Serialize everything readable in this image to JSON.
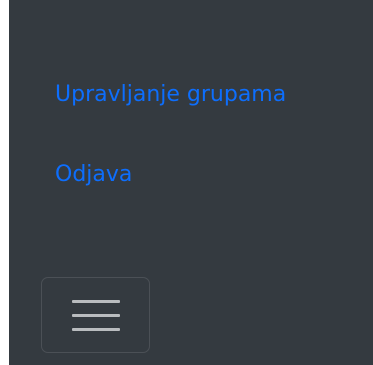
{
  "navbar": {
    "background_color": "#343a40",
    "link_color": "#0d6efd",
    "links": [
      {
        "label": "Upravljanje grupama"
      },
      {
        "label": "Odjava"
      }
    ],
    "toggler": {
      "icon": "hamburger-icon"
    }
  }
}
